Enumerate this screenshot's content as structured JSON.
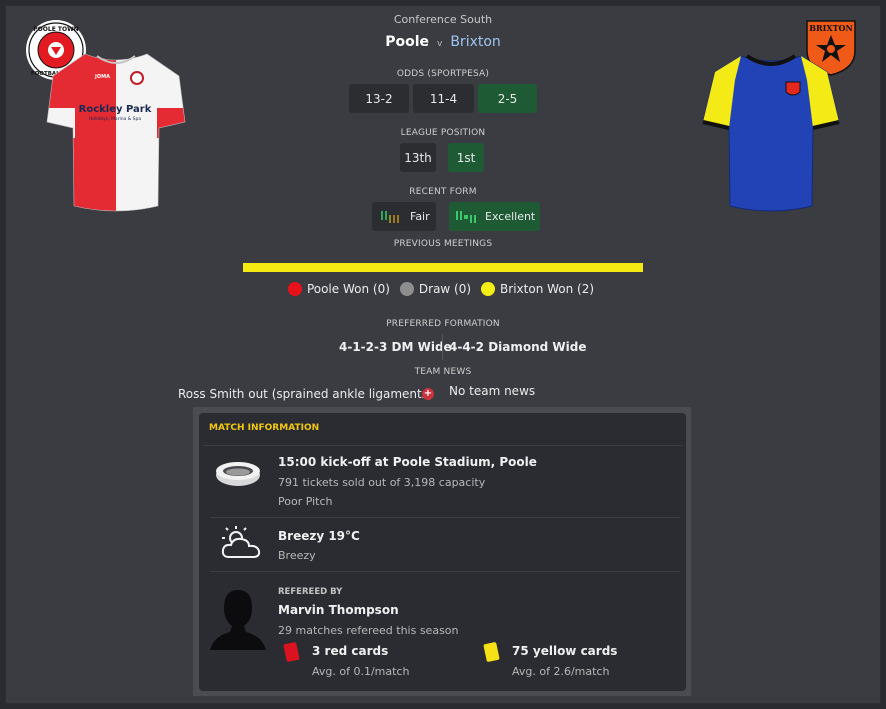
{
  "competition": "Conference South",
  "fixture": {
    "home": "Poole",
    "vs": "v",
    "away": "Brixton"
  },
  "home_kit": {
    "sponsor_line1": "Rockley Park",
    "sponsor_line2": "Holidays, Marina & Spa",
    "maker": "JOMA"
  },
  "odds": {
    "label": "ODDS (SPORTPESA)",
    "values": [
      "13-2",
      "11-4",
      "2-5"
    ]
  },
  "league_position": {
    "label": "LEAGUE POSITION",
    "home": "13th",
    "away": "1st"
  },
  "recent_form": {
    "label": "RECENT FORM",
    "home": "Fair",
    "away": "Excellent"
  },
  "previous_meetings": {
    "label": "PREVIOUS MEETINGS",
    "home_won": "Poole Won (0)",
    "draw": "Draw (0)",
    "away_won": "Brixton Won (2)"
  },
  "preferred_formation": {
    "label": "PREFERRED FORMATION",
    "home": "4-1-2-3 DM Wide",
    "away": "4-4-2 Diamond Wide"
  },
  "team_news": {
    "label": "TEAM NEWS",
    "home": "Ross Smith out (sprained ankle ligaments)",
    "away": "No team news"
  },
  "match_info": {
    "title": "MATCH INFORMATION",
    "kickoff": "15:00 kick-off at Poole Stadium, Poole",
    "tickets": "791 tickets sold out of 3,198 capacity",
    "pitch": "Poor Pitch",
    "weather": "Breezy 19°C",
    "weather_sub": "Breezy",
    "referee_label": "REFEREED BY",
    "referee": "Marvin Thompson",
    "referee_matches": "29 matches refereed this season",
    "red_cards": "3 red cards",
    "red_avg": "Avg. of 0.1/match",
    "yellow_cards": "75 yellow cards",
    "yellow_avg": "Avg. of 2.6/match"
  },
  "colors": {
    "background": "#3b3c41",
    "pill": "#2c2d31",
    "pill_green": "#1e5b35",
    "accent_title": "#f2c80f",
    "meetings_bar": "#f5ea12",
    "home_red": "#e8111a",
    "away_blue": "#1f3aa8",
    "away_yellow": "#f4ef16"
  },
  "icons": [
    "poole-crest-icon",
    "brixton-crest-icon",
    "stadium-icon",
    "cloud-sun-icon",
    "referee-silhouette-icon",
    "injury-icon",
    "red-card-icon",
    "yellow-card-icon"
  ]
}
